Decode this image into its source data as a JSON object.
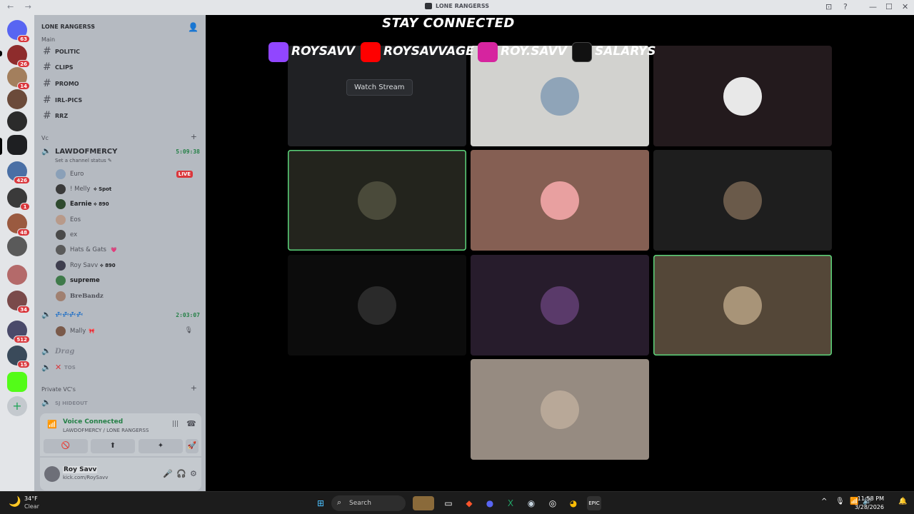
{
  "titlebar": {
    "nav": "← →",
    "title": "LONE RANGERSS",
    "inbox_icon": "⊡",
    "help_icon": "?",
    "min": "—",
    "max": "☐",
    "close": "✕"
  },
  "rail": {
    "badges": [
      "63",
      "26",
      "14",
      "426",
      "1",
      "48",
      "34",
      "512",
      "15"
    ]
  },
  "sidebar": {
    "guild_name": "LONE RANGERSS",
    "chevron": "⌄",
    "invite_icon": "👤",
    "partial_category": "Main",
    "channels": [
      "POLITIC",
      "CLIPS",
      "PROMO",
      "IRL-PICS",
      "RRZ"
    ],
    "vc_category": "Vc",
    "vc_add": "+",
    "voice_channel_1": {
      "name": "LAWDOFMERCY",
      "timer": "5:09:38",
      "status_hint": "Set a channel status ✎"
    },
    "members_1": [
      {
        "name": "Euro",
        "tag": ""
      },
      {
        "name": "! Melly",
        "tag": "⟡ Spot"
      },
      {
        "name": "Earnie",
        "tag": "⟡ 890"
      },
      {
        "name": "Eos",
        "tag": ""
      },
      {
        "name": "ex",
        "tag": ""
      },
      {
        "name": "Hats & Gats",
        "tag": "💗"
      },
      {
        "name": "Roy Savv",
        "tag": "⟡ 890"
      },
      {
        "name": "supreme",
        "tag": ""
      },
      {
        "name": "BreBandz",
        "tag": ""
      }
    ],
    "live_label": "LIVE",
    "voice_channel_2": {
      "name": "💤💤💤💤",
      "timer": "2:03:07"
    },
    "members_2": [
      {
        "name": "Mally",
        "tag": "🎀"
      }
    ],
    "voice_channel_3": {
      "name": "Drag"
    },
    "voice_channel_4": {
      "name": "TOS",
      "prefix": "✕"
    },
    "private_category": "Private VC's",
    "private_add": "+",
    "voice_channel_5": {
      "name": "SJ HIDEOUT"
    }
  },
  "voice_panel": {
    "status": "Voice Connected",
    "sub": "LAWDOFMERCY / LONE RANGERSS",
    "buttons": [
      "🚫",
      "⬆",
      "✦",
      "🚀"
    ],
    "wave_icon": "|||",
    "disconnect_icon": "☎"
  },
  "user_panel": {
    "name": "Roy Savv",
    "status": "kick.com/RoySavv",
    "mic_icon": "🎤",
    "headset_icon": "🎧",
    "settings_icon": "⚙"
  },
  "stage": {
    "banner_title": "STAY CONNECTED",
    "socials": [
      {
        "platform": "twitch",
        "handle": "ROYSAVV",
        "color": "#9146ff"
      },
      {
        "platform": "youtube",
        "handle": "ROYSAVVAGE",
        "color": "#ff0000"
      },
      {
        "platform": "instagram",
        "handle": "ROY.SAVV",
        "color": "#d6249f"
      },
      {
        "platform": "tiktok",
        "handle": "SALARYS",
        "color": "#111111"
      }
    ],
    "watch_stream": "Watch Stream"
  },
  "taskbar": {
    "weather_icon": "🌙",
    "temp": "34°F",
    "weather": "Clear",
    "search": "Search",
    "time": "11:58 PM",
    "date": "3/28/2026",
    "tray_up": "^",
    "tray_mic": "🎙",
    "tray_wifi": "📶",
    "tray_volume": "🔊"
  }
}
